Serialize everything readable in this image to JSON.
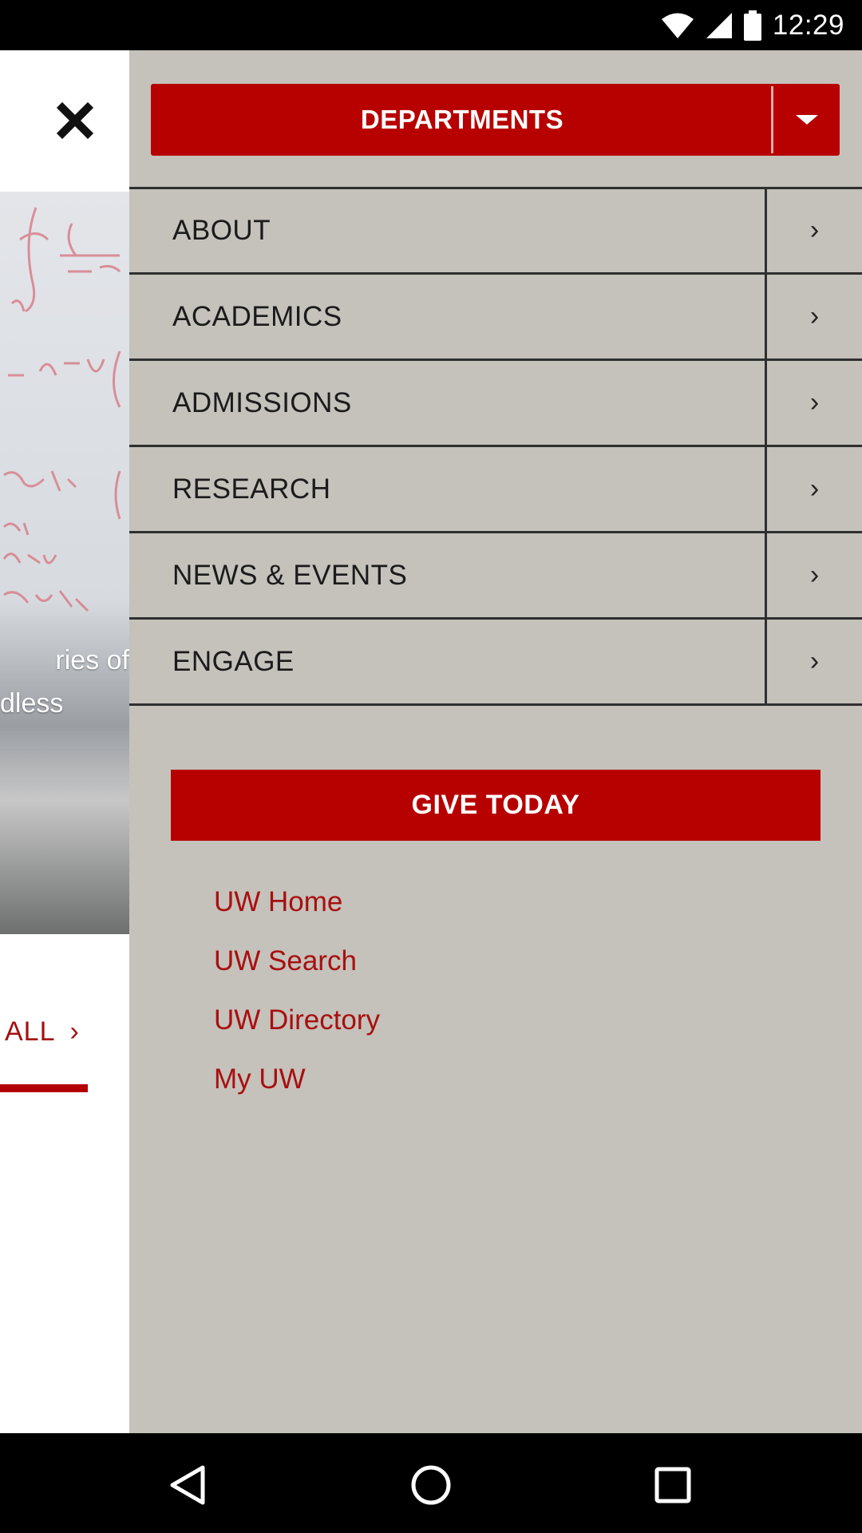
{
  "status_bar": {
    "time": "12:29",
    "icons": [
      "wifi-icon",
      "cell-signal-icon",
      "battery-icon"
    ]
  },
  "background_page": {
    "hero_caption_lines": [
      "ries of",
      "dless"
    ],
    "see_all_label": "ALL",
    "see_all_chevron": "›"
  },
  "drawer": {
    "departments_label": "DEPARTMENTS",
    "menu_items": [
      {
        "label": "ABOUT",
        "chevron": "›"
      },
      {
        "label": "ACADEMICS",
        "chevron": "›"
      },
      {
        "label": "ADMISSIONS",
        "chevron": "›"
      },
      {
        "label": "RESEARCH",
        "chevron": "›"
      },
      {
        "label": "NEWS & EVENTS",
        "chevron": "›"
      },
      {
        "label": "ENGAGE",
        "chevron": "›"
      }
    ],
    "give_label": "GIVE TODAY",
    "links": [
      "UW Home",
      "UW Search",
      "UW Directory",
      "My UW"
    ]
  },
  "colors": {
    "brand_red": "#b70000",
    "link_red": "#a80f0f",
    "drawer_bg": "#c5c1bb"
  },
  "nav_bar": {
    "icons": [
      "back-triangle-icon",
      "home-circle-icon",
      "recents-square-icon"
    ]
  }
}
